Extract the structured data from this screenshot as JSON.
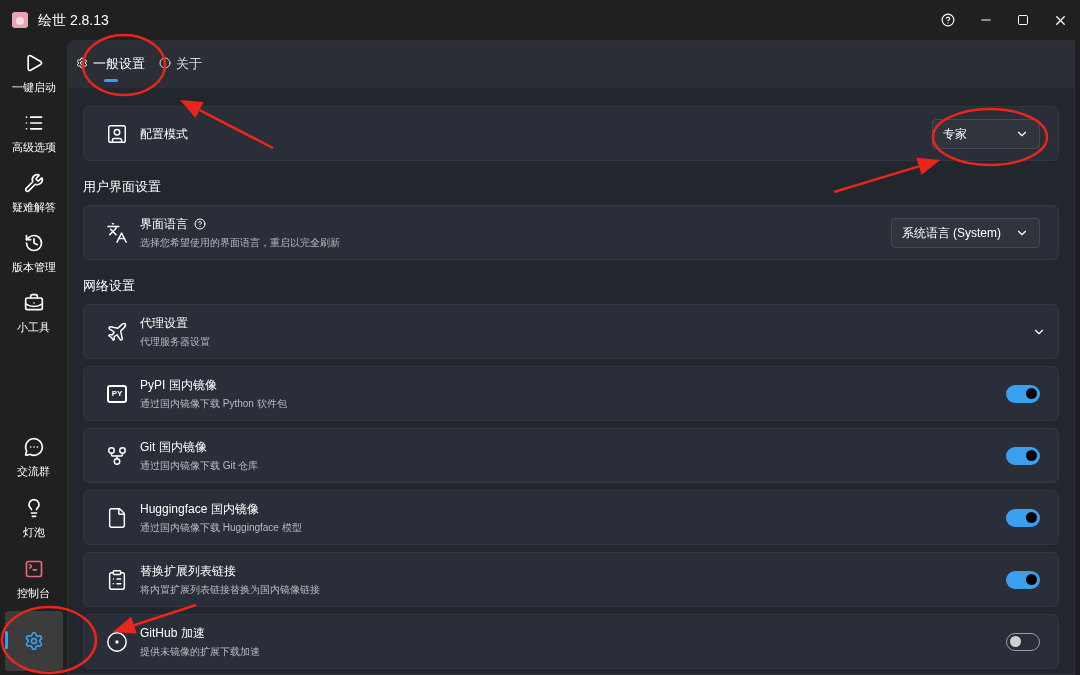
{
  "window": {
    "title": "绘世 2.8.13"
  },
  "sidebar": {
    "top": [
      {
        "kind": "play",
        "label": "一键启动",
        "selected": false
      },
      {
        "kind": "list",
        "label": "高级选项",
        "selected": false
      },
      {
        "kind": "tools",
        "label": "疑难解答",
        "selected": false
      },
      {
        "kind": "history",
        "label": "版本管理",
        "selected": false
      },
      {
        "kind": "toolbox",
        "label": "小工具",
        "selected": false
      }
    ],
    "bottom": [
      {
        "kind": "chat",
        "label": "交流群",
        "selected": false
      },
      {
        "kind": "bulb",
        "label": "灯泡",
        "selected": false
      },
      {
        "kind": "terminal",
        "label": "控制台",
        "selected": false
      },
      {
        "kind": "settings",
        "selected": true
      }
    ]
  },
  "tabs": [
    {
      "kind": "gear",
      "label": "一般设置",
      "selected": true
    },
    {
      "kind": "info",
      "label": "关于",
      "selected": false
    }
  ],
  "sections": [
    {
      "cards": [
        {
          "kind": "select",
          "title": "配置模式",
          "value": "专家"
        }
      ]
    },
    {
      "heading": "用户界面设置",
      "cards": [
        {
          "kind": "select",
          "title": "界面语言",
          "help": true,
          "description": "选择您希望使用的界面语言，重启以完全刷新",
          "value": "系统语言 (System)"
        }
      ]
    },
    {
      "heading": "网络设置",
      "cards": [
        {
          "kind": "expander",
          "title": "代理设置",
          "description": "代理服务器设置",
          "expanded": false
        },
        {
          "kind": "toggle",
          "icon_text": "PY",
          "title": "PyPI 国内镜像",
          "description": "通过国内镜像下载 Python 软件包",
          "on": true
        },
        {
          "kind": "toggle",
          "title": "Git 国内镜像",
          "description": "通过国内镜像下载 Git 仓库",
          "on": true
        },
        {
          "kind": "toggle",
          "title": "Huggingface 国内镜像",
          "description": "通过国内镜像下载 Huggingface 模型",
          "on": true
        },
        {
          "kind": "toggle",
          "title": "替换扩展列表链接",
          "description": "将内置扩展列表链接替换为国内镜像链接",
          "on": true
        },
        {
          "kind": "toggle",
          "title": "GitHub 加速",
          "description": "提供未镜像的扩展下载加速",
          "on": false
        }
      ]
    }
  ]
}
